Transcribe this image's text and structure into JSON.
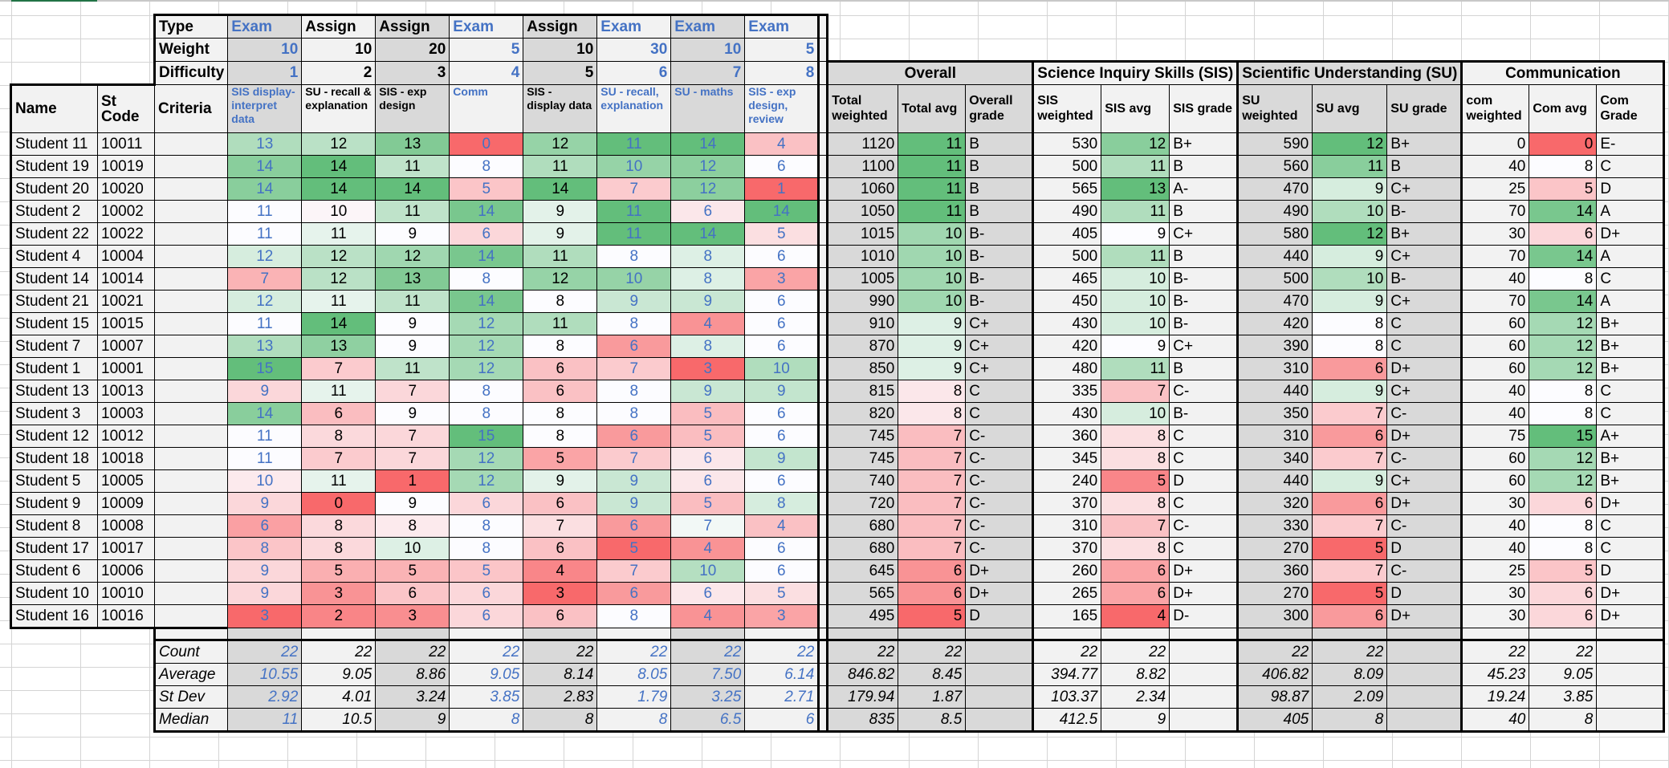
{
  "sheet": {
    "top_labels": [
      "Type",
      "Weight",
      "Difficulty"
    ],
    "types": [
      "Exam",
      "Assign",
      "Assign",
      "Exam",
      "Assign",
      "Exam",
      "Exam",
      "Exam"
    ],
    "weights": [
      10,
      10,
      20,
      5,
      10,
      30,
      10,
      5
    ],
    "difficulty": [
      1,
      2,
      3,
      4,
      5,
      6,
      7,
      8
    ],
    "group_headers": [
      "Overall",
      "Science Inquiry Skills (SIS)",
      "Scientific Understanding (SU)",
      "Communication"
    ],
    "col_headers": {
      "name": "Name",
      "code": "St Code",
      "criteria_label": "Criteria",
      "criteria": [
        "SIS display-interpret data",
        "SU - recall & explanation",
        "SIS - exp design",
        "Comm",
        "SIS - display data",
        "SU - recall, explanation",
        "SU - maths",
        "SIS - exp design, review"
      ],
      "overall": [
        "Total weighted",
        "Total avg",
        "Overall grade"
      ],
      "sis": [
        "SIS weighted",
        "SIS avg",
        "SIS grade"
      ],
      "su": [
        "SU weighted",
        "SU avg",
        "SU grade"
      ],
      "com": [
        "com weighted",
        "Com avg",
        "Com Grade"
      ]
    },
    "students": [
      {
        "name": "Student 11",
        "code": "10011",
        "scores": [
          13,
          12,
          13,
          0,
          12,
          11,
          14,
          4
        ],
        "total": 1120,
        "total_avg": 11,
        "grade": "B",
        "sis_w": 530,
        "sis_avg": 12,
        "sis_grade": "B+",
        "su_w": 590,
        "su_avg": 12,
        "su_grade": "B+",
        "com_w": 0,
        "com_avg": 0,
        "com_grade": "E-"
      },
      {
        "name": "Student 19",
        "code": "10019",
        "scores": [
          14,
          14,
          11,
          8,
          11,
          10,
          12,
          6
        ],
        "total": 1100,
        "total_avg": 11,
        "grade": "B",
        "sis_w": 500,
        "sis_avg": 11,
        "sis_grade": "B",
        "su_w": 560,
        "su_avg": 11,
        "su_grade": "B",
        "com_w": 40,
        "com_avg": 8,
        "com_grade": "C"
      },
      {
        "name": "Student 20",
        "code": "10020",
        "scores": [
          14,
          14,
          14,
          5,
          14,
          7,
          12,
          1
        ],
        "total": 1060,
        "total_avg": 11,
        "grade": "B",
        "sis_w": 565,
        "sis_avg": 13,
        "sis_grade": "A-",
        "su_w": 470,
        "su_avg": 9,
        "su_grade": "C+",
        "com_w": 25,
        "com_avg": 5,
        "com_grade": "D"
      },
      {
        "name": "Student 2",
        "code": "10002",
        "scores": [
          11,
          10,
          11,
          14,
          9,
          11,
          6,
          14
        ],
        "total": 1050,
        "total_avg": 11,
        "grade": "B",
        "sis_w": 490,
        "sis_avg": 11,
        "sis_grade": "B",
        "su_w": 490,
        "su_avg": 10,
        "su_grade": "B-",
        "com_w": 70,
        "com_avg": 14,
        "com_grade": "A"
      },
      {
        "name": "Student 22",
        "code": "10022",
        "scores": [
          11,
          11,
          9,
          6,
          9,
          11,
          14,
          5
        ],
        "total": 1015,
        "total_avg": 10,
        "grade": "B-",
        "sis_w": 405,
        "sis_avg": 9,
        "sis_grade": "C+",
        "su_w": 580,
        "su_avg": 12,
        "su_grade": "B+",
        "com_w": 30,
        "com_avg": 6,
        "com_grade": "D+"
      },
      {
        "name": "Student 4",
        "code": "10004",
        "scores": [
          12,
          12,
          12,
          14,
          11,
          8,
          8,
          6
        ],
        "total": 1010,
        "total_avg": 10,
        "grade": "B-",
        "sis_w": 500,
        "sis_avg": 11,
        "sis_grade": "B",
        "su_w": 440,
        "su_avg": 9,
        "su_grade": "C+",
        "com_w": 70,
        "com_avg": 14,
        "com_grade": "A"
      },
      {
        "name": "Student 14",
        "code": "10014",
        "scores": [
          7,
          12,
          13,
          8,
          12,
          10,
          8,
          3
        ],
        "total": 1005,
        "total_avg": 10,
        "grade": "B-",
        "sis_w": 465,
        "sis_avg": 10,
        "sis_grade": "B-",
        "su_w": 500,
        "su_avg": 10,
        "su_grade": "B-",
        "com_w": 40,
        "com_avg": 8,
        "com_grade": "C"
      },
      {
        "name": "Student 21",
        "code": "10021",
        "scores": [
          12,
          11,
          11,
          14,
          8,
          9,
          9,
          6
        ],
        "total": 990,
        "total_avg": 10,
        "grade": "B-",
        "sis_w": 450,
        "sis_avg": 10,
        "sis_grade": "B-",
        "su_w": 470,
        "su_avg": 9,
        "su_grade": "C+",
        "com_w": 70,
        "com_avg": 14,
        "com_grade": "A"
      },
      {
        "name": "Student 15",
        "code": "10015",
        "scores": [
          11,
          14,
          9,
          12,
          11,
          8,
          4,
          6
        ],
        "total": 910,
        "total_avg": 9,
        "grade": "C+",
        "sis_w": 430,
        "sis_avg": 10,
        "sis_grade": "B-",
        "su_w": 420,
        "su_avg": 8,
        "su_grade": "C",
        "com_w": 60,
        "com_avg": 12,
        "com_grade": "B+"
      },
      {
        "name": "Student 7",
        "code": "10007",
        "scores": [
          13,
          13,
          9,
          12,
          8,
          6,
          8,
          6
        ],
        "total": 870,
        "total_avg": 9,
        "grade": "C+",
        "sis_w": 420,
        "sis_avg": 9,
        "sis_grade": "C+",
        "su_w": 390,
        "su_avg": 8,
        "su_grade": "C",
        "com_w": 60,
        "com_avg": 12,
        "com_grade": "B+"
      },
      {
        "name": "Student 1",
        "code": "10001",
        "scores": [
          15,
          7,
          11,
          12,
          6,
          7,
          3,
          10
        ],
        "total": 850,
        "total_avg": 9,
        "grade": "C+",
        "sis_w": 480,
        "sis_avg": 11,
        "sis_grade": "B",
        "su_w": 310,
        "su_avg": 6,
        "su_grade": "D+",
        "com_w": 60,
        "com_avg": 12,
        "com_grade": "B+"
      },
      {
        "name": "Student 13",
        "code": "10013",
        "scores": [
          9,
          11,
          7,
          8,
          6,
          8,
          9,
          9
        ],
        "total": 815,
        "total_avg": 8,
        "grade": "C",
        "sis_w": 335,
        "sis_avg": 7,
        "sis_grade": "C-",
        "su_w": 440,
        "su_avg": 9,
        "su_grade": "C+",
        "com_w": 40,
        "com_avg": 8,
        "com_grade": "C"
      },
      {
        "name": "Student 3",
        "code": "10003",
        "scores": [
          14,
          6,
          9,
          8,
          8,
          8,
          5,
          6
        ],
        "total": 820,
        "total_avg": 8,
        "grade": "C",
        "sis_w": 430,
        "sis_avg": 10,
        "sis_grade": "B-",
        "su_w": 350,
        "su_avg": 7,
        "su_grade": "C-",
        "com_w": 40,
        "com_avg": 8,
        "com_grade": "C"
      },
      {
        "name": "Student 12",
        "code": "10012",
        "scores": [
          11,
          8,
          7,
          15,
          8,
          6,
          5,
          6
        ],
        "total": 745,
        "total_avg": 7,
        "grade": "C-",
        "sis_w": 360,
        "sis_avg": 8,
        "sis_grade": "C",
        "su_w": 310,
        "su_avg": 6,
        "su_grade": "D+",
        "com_w": 75,
        "com_avg": 15,
        "com_grade": "A+"
      },
      {
        "name": "Student 18",
        "code": "10018",
        "scores": [
          11,
          7,
          7,
          12,
          5,
          7,
          6,
          9
        ],
        "total": 745,
        "total_avg": 7,
        "grade": "C-",
        "sis_w": 345,
        "sis_avg": 8,
        "sis_grade": "C",
        "su_w": 340,
        "su_avg": 7,
        "su_grade": "C-",
        "com_w": 60,
        "com_avg": 12,
        "com_grade": "B+"
      },
      {
        "name": "Student 5",
        "code": "10005",
        "scores": [
          10,
          11,
          1,
          12,
          9,
          9,
          6,
          6
        ],
        "total": 740,
        "total_avg": 7,
        "grade": "C-",
        "sis_w": 240,
        "sis_avg": 5,
        "sis_grade": "D",
        "su_w": 440,
        "su_avg": 9,
        "su_grade": "C+",
        "com_w": 60,
        "com_avg": 12,
        "com_grade": "B+"
      },
      {
        "name": "Student 9",
        "code": "10009",
        "scores": [
          9,
          0,
          9,
          6,
          6,
          9,
          5,
          8
        ],
        "total": 720,
        "total_avg": 7,
        "grade": "C-",
        "sis_w": 370,
        "sis_avg": 8,
        "sis_grade": "C",
        "su_w": 320,
        "su_avg": 6,
        "su_grade": "D+",
        "com_w": 30,
        "com_avg": 6,
        "com_grade": "D+"
      },
      {
        "name": "Student 8",
        "code": "10008",
        "scores": [
          6,
          8,
          8,
          8,
          7,
          6,
          7,
          4
        ],
        "total": 680,
        "total_avg": 7,
        "grade": "C-",
        "sis_w": 310,
        "sis_avg": 7,
        "sis_grade": "C-",
        "su_w": 330,
        "su_avg": 7,
        "su_grade": "C-",
        "com_w": 40,
        "com_avg": 8,
        "com_grade": "C"
      },
      {
        "name": "Student 17",
        "code": "10017",
        "scores": [
          8,
          8,
          10,
          8,
          6,
          5,
          4,
          6
        ],
        "total": 680,
        "total_avg": 7,
        "grade": "C-",
        "sis_w": 370,
        "sis_avg": 8,
        "sis_grade": "C",
        "su_w": 270,
        "su_avg": 5,
        "su_grade": "D",
        "com_w": 40,
        "com_avg": 8,
        "com_grade": "C"
      },
      {
        "name": "Student 6",
        "code": "10006",
        "scores": [
          9,
          5,
          5,
          5,
          4,
          7,
          10,
          6
        ],
        "total": 645,
        "total_avg": 6,
        "grade": "D+",
        "sis_w": 260,
        "sis_avg": 6,
        "sis_grade": "D+",
        "su_w": 360,
        "su_avg": 7,
        "su_grade": "C-",
        "com_w": 25,
        "com_avg": 5,
        "com_grade": "D"
      },
      {
        "name": "Student 10",
        "code": "10010",
        "scores": [
          9,
          3,
          6,
          6,
          3,
          6,
          6,
          5
        ],
        "total": 565,
        "total_avg": 6,
        "grade": "D+",
        "sis_w": 265,
        "sis_avg": 6,
        "sis_grade": "D+",
        "su_w": 270,
        "su_avg": 5,
        "su_grade": "D",
        "com_w": 30,
        "com_avg": 6,
        "com_grade": "D+"
      },
      {
        "name": "Student 16",
        "code": "10016",
        "scores": [
          3,
          2,
          3,
          6,
          6,
          8,
          4,
          3
        ],
        "total": 495,
        "total_avg": 5,
        "grade": "D",
        "sis_w": 165,
        "sis_avg": 4,
        "sis_grade": "D-",
        "su_w": 300,
        "su_avg": 6,
        "su_grade": "D+",
        "com_w": 30,
        "com_avg": 6,
        "com_grade": "D+"
      }
    ],
    "stats": [
      {
        "label": "Count",
        "scores": [
          "22",
          "22",
          "22",
          "22",
          "22",
          "22",
          "22",
          "22"
        ],
        "overall": [
          "22",
          "22"
        ],
        "sis": [
          "22",
          "22"
        ],
        "su": [
          "22",
          "22"
        ],
        "com": [
          "22",
          "22"
        ]
      },
      {
        "label": "Average",
        "scores": [
          "10.55",
          "9.05",
          "8.86",
          "9.05",
          "8.14",
          "8.05",
          "7.50",
          "6.14"
        ],
        "overall": [
          "846.82",
          "8.45"
        ],
        "sis": [
          "394.77",
          "8.82"
        ],
        "su": [
          "406.82",
          "8.09"
        ],
        "com": [
          "45.23",
          "9.05"
        ]
      },
      {
        "label": "St Dev",
        "scores": [
          "2.92",
          "4.01",
          "3.24",
          "3.85",
          "2.83",
          "1.79",
          "3.25",
          "2.71"
        ],
        "overall": [
          "179.94",
          "1.87"
        ],
        "sis": [
          "103.37",
          "2.34"
        ],
        "su": [
          "98.87",
          "2.09"
        ],
        "com": [
          "19.24",
          "3.85"
        ]
      },
      {
        "label": "Median",
        "scores": [
          "11",
          "10.5",
          "9",
          "8",
          "8",
          "8",
          "6.5",
          "6"
        ],
        "overall": [
          "835",
          "8.5"
        ],
        "sis": [
          "412.5",
          "9"
        ],
        "su": [
          "405",
          "8"
        ],
        "com": [
          "40",
          "8"
        ]
      }
    ],
    "colors": {
      "exam_text": "#4472c4",
      "scale_low": "#f8696b",
      "scale_mid": "#fcfcff",
      "scale_high": "#63be7b",
      "header_gray": "#d9d9d9",
      "header_light": "#f2f2f2"
    }
  }
}
